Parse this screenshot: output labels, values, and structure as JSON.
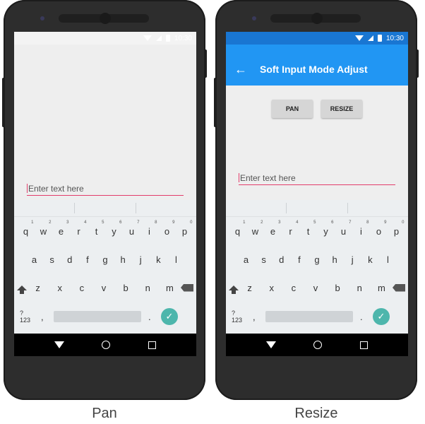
{
  "captions": {
    "left": "Pan",
    "right": "Resize"
  },
  "status": {
    "time": "10:30"
  },
  "pan_screen": {
    "field_placeholder": "Enter text here"
  },
  "resize_screen": {
    "title": "Soft Input Mode Adjust",
    "back_icon": "arrow-back-icon",
    "buttons": [
      "PAN",
      "RESIZE"
    ],
    "field_placeholder": "Enter text here"
  },
  "keyboard": {
    "row1": [
      {
        "k": "q",
        "n": "1"
      },
      {
        "k": "w",
        "n": "2"
      },
      {
        "k": "e",
        "n": "3"
      },
      {
        "k": "r",
        "n": "4"
      },
      {
        "k": "t",
        "n": "5"
      },
      {
        "k": "y",
        "n": "6"
      },
      {
        "k": "u",
        "n": "7"
      },
      {
        "k": "i",
        "n": "8"
      },
      {
        "k": "o",
        "n": "9"
      },
      {
        "k": "p",
        "n": "0"
      }
    ],
    "row2": [
      "a",
      "s",
      "d",
      "f",
      "g",
      "h",
      "j",
      "k",
      "l"
    ],
    "row3": [
      "z",
      "x",
      "c",
      "v",
      "b",
      "n",
      "m"
    ],
    "symbols_label": "?123",
    "comma": ",",
    "period": "."
  },
  "colors": {
    "accent_blue": "#2196f3",
    "status_blue": "#1976d2",
    "underline_pink": "#e23d6b",
    "enter_teal": "#4db6ac"
  }
}
